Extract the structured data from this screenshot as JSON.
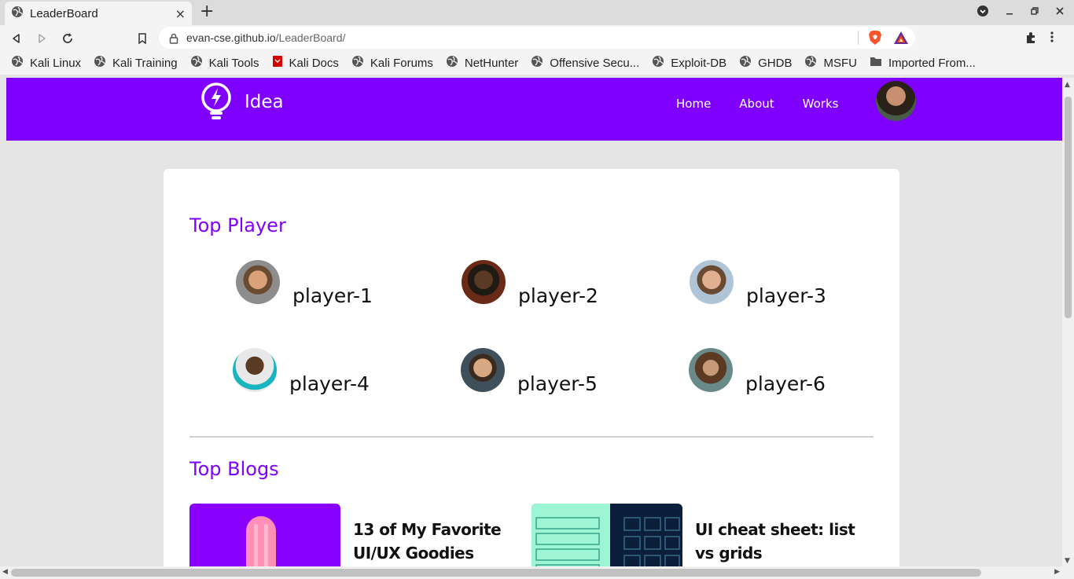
{
  "browser": {
    "tab_title": "LeaderBoard",
    "tab_close": "×",
    "new_tab": "+",
    "url_host": "evan-cse.github.io",
    "url_path": "/LeaderBoard/",
    "bookmarks": [
      {
        "label": "Kali Linux",
        "icon": "globe-icon"
      },
      {
        "label": "Kali Training",
        "icon": "globe-icon"
      },
      {
        "label": "Kali Tools",
        "icon": "globe-icon"
      },
      {
        "label": "Kali Docs",
        "icon": "kali-docs-icon"
      },
      {
        "label": "Kali Forums",
        "icon": "globe-icon"
      },
      {
        "label": "NetHunter",
        "icon": "globe-icon"
      },
      {
        "label": "Offensive Secu...",
        "icon": "globe-icon"
      },
      {
        "label": "Exploit-DB",
        "icon": "globe-icon"
      },
      {
        "label": "GHDB",
        "icon": "globe-icon"
      },
      {
        "label": "MSFU",
        "icon": "globe-icon"
      },
      {
        "label": "Imported From...",
        "icon": "folder-icon"
      }
    ]
  },
  "site": {
    "brand": "Idea",
    "nav": [
      "Home",
      "About",
      "Works"
    ]
  },
  "leaderboard": {
    "players_title": "Top Player",
    "players": [
      {
        "name": "player-1"
      },
      {
        "name": "player-2"
      },
      {
        "name": "player-3"
      },
      {
        "name": "player-4"
      },
      {
        "name": "player-5"
      },
      {
        "name": "player-6"
      }
    ],
    "blogs_title": "Top Blogs",
    "blogs": [
      {
        "title": "13 of My Favorite UI/UX Goodies"
      },
      {
        "title": "UI cheat sheet: list vs grids"
      }
    ]
  },
  "colors": {
    "brand_purple": "#8000ff",
    "chrome_bg": "#f4f4f4",
    "page_bg": "#e5e5e5"
  }
}
